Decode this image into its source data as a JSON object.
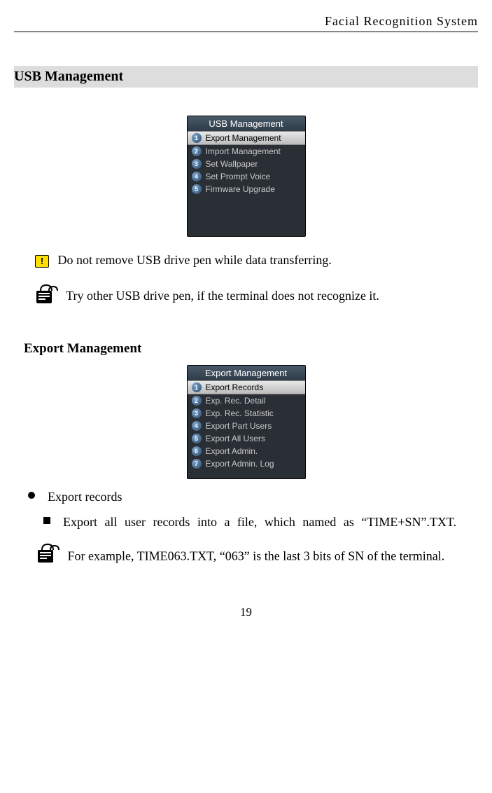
{
  "header": {
    "product": "Facial  Recognition  System"
  },
  "section_title": "USB Management",
  "usb_panel": {
    "title": "USB Management",
    "items": [
      {
        "num": "1",
        "label": "Export Management",
        "selected": true
      },
      {
        "num": "2",
        "label": "Import Management",
        "selected": false
      },
      {
        "num": "3",
        "label": "Set Wallpaper",
        "selected": false
      },
      {
        "num": "4",
        "label": "Set Prompt Voice",
        "selected": false
      },
      {
        "num": "5",
        "label": "Firmware Upgrade",
        "selected": false
      }
    ]
  },
  "warning_text": "Do not remove USB drive pen while data transferring.",
  "tip_text": "Try other USB drive pen, if the terminal does not recognize it.",
  "sub_section": "Export Management",
  "export_panel": {
    "title": "Export Management",
    "items": [
      {
        "num": "1",
        "label": "Export Records",
        "selected": true
      },
      {
        "num": "2",
        "label": "Exp. Rec. Detail",
        "selected": false
      },
      {
        "num": "3",
        "label": "Exp. Rec. Statistic",
        "selected": false
      },
      {
        "num": "4",
        "label": "Export Part Users",
        "selected": false
      },
      {
        "num": "5",
        "label": "Export All Users",
        "selected": false
      },
      {
        "num": "6",
        "label": "Export Admin.",
        "selected": false
      },
      {
        "num": "7",
        "label": "Export Admin. Log",
        "selected": false
      }
    ]
  },
  "export_records_heading": "Export records",
  "export_records_desc": "Export all user records into a file, which named as “TIME+SN”.TXT.",
  "example_text": "For example, TIME063.TXT, “063” is the last 3 bits of SN of the terminal.",
  "page_number": "19",
  "icons": {
    "warning_glyph": "!"
  }
}
